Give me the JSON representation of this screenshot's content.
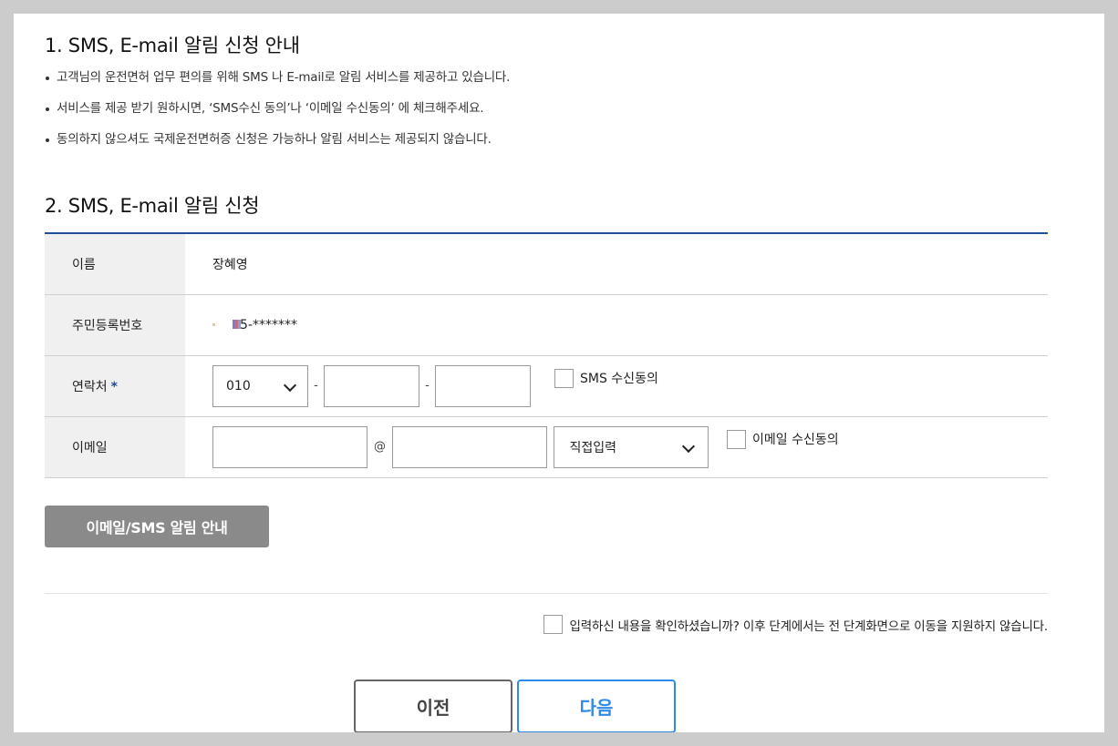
{
  "section1": {
    "title": "1. SMS, E-mail 알림 신청 안내",
    "notes": [
      "고객님의 운전면허 업무 편의를 위해 SMS 나 E-mail로 알림 서비스를 제공하고 있습니다.",
      "서비스를 제공 받기 원하시면, ‘SMS수신 동의’나 ‘이메일 수신동의’ 에 체크해주세요.",
      "동의하지 않으셔도 국제운전면허증 신청은 가능하나 알림 서비스는 제공되지 않습니다."
    ]
  },
  "section2": {
    "title": "2. SMS, E-mail 알림 신청"
  },
  "form": {
    "name_label": "이름",
    "name_value": "장혜영",
    "ssn_label": "주민등록번호",
    "ssn_value": "5-*******",
    "phone_label": "연락처",
    "phone_required": "*",
    "phone_prefix": "010",
    "phone_sep1": "-",
    "phone_sep2": "-",
    "phone_mid": "",
    "phone_last": "",
    "sms_consent_label": "SMS 수신동의",
    "email_label": "이메일",
    "email_local": "",
    "email_at": "@",
    "email_domain": "",
    "email_domain_select": "직접입력",
    "email_consent_label": "이메일 수신동의"
  },
  "guide_button": "이메일/SMS 알림 안내",
  "confirm_text": "입력하신 내용을 확인하셨습니까? 이후 단계에서는 전 단계화면으로 이동을 지원하지 않습니다.",
  "buttons": {
    "prev": "이전",
    "next": "다음"
  },
  "colors": {
    "accent": "#1f4e96",
    "next_button": "#2e8ae6",
    "guide_button_bg": "#8a8a8a"
  }
}
